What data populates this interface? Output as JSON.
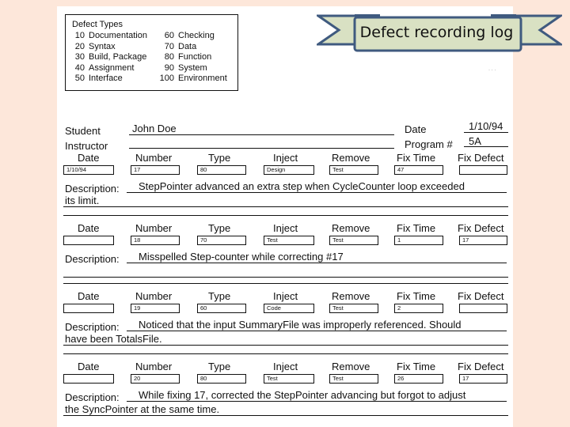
{
  "banner": {
    "title": "Defect recording log",
    "fill": "#d9e1c3",
    "stroke": "#3f5a7f"
  },
  "defect_types": {
    "title": "Defect Types",
    "left": [
      {
        "code": "10",
        "name": "Documentation"
      },
      {
        "code": "20",
        "name": "Syntax"
      },
      {
        "code": "30",
        "name": "Build, Package"
      },
      {
        "code": "40",
        "name": "Assignment"
      },
      {
        "code": "50",
        "name": "Interface"
      }
    ],
    "right": [
      {
        "code": "60",
        "name": "Checking"
      },
      {
        "code": "70",
        "name": "Data"
      },
      {
        "code": "80",
        "name": "Function"
      },
      {
        "code": "90",
        "name": "System"
      },
      {
        "code": "100",
        "name": "Environment"
      }
    ]
  },
  "header": {
    "student_label": "Student",
    "student_value": "John Doe",
    "instructor_label": "Instructor",
    "instructor_value": "",
    "date_label": "Date",
    "date_value": "1/10/94",
    "program_label": "Program #",
    "program_value": "5A"
  },
  "columns": {
    "date": "Date",
    "number": "Number",
    "type": "Type",
    "inject": "Inject",
    "remove": "Remove",
    "fix_time": "Fix Time",
    "fix_defect": "Fix Defect",
    "description": "Description:"
  },
  "entries": [
    {
      "date": "1/10/94",
      "number": "17",
      "type": "80",
      "inject": "Design",
      "remove": "Test",
      "fix_time": "47",
      "fix_defect": "",
      "description_line1": "StepPointer advanced an extra step when CycleCounter loop exceeded",
      "description_line2": "its limit."
    },
    {
      "date": "",
      "number": "18",
      "type": "70",
      "inject": "Test",
      "remove": "Test",
      "fix_time": "1",
      "fix_defect": "17",
      "description_line1": "Misspelled Step-counter while correcting #17",
      "description_line2": ""
    },
    {
      "date": "",
      "number": "19",
      "type": "60",
      "inject": "Code",
      "remove": "Test",
      "fix_time": "2",
      "fix_defect": "",
      "description_line1": "Noticed that the input SummaryFile was improperly referenced. Should",
      "description_line2": "have been TotalsFile."
    },
    {
      "date": "",
      "number": "20",
      "type": "80",
      "inject": "Test",
      "remove": "Test",
      "fix_time": "26",
      "fix_defect": "17",
      "description_line1": "While fixing 17, corrected the StepPointer advancing but forgot to adjust",
      "description_line2": "the SyncPointer at the same time."
    }
  ]
}
